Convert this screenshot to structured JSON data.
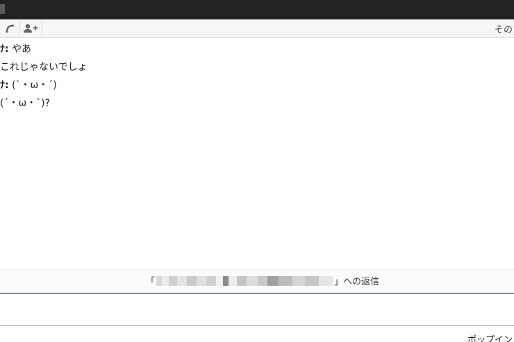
{
  "toolbar": {
    "call_icon": "phone-handset-icon",
    "add_person_icon": "add-person-icon",
    "more_label": "その"
  },
  "messages": [
    {
      "sender": "ﾅ:",
      "text": "やあ",
      "sender_visible": true
    },
    {
      "sender": "",
      "text": "これじゃないでしょ",
      "sender_visible": false
    },
    {
      "sender": "ﾅ:",
      "text": "(`・ω・´)",
      "sender_visible": true
    },
    {
      "sender": "",
      "text": "(´・ω・`)?",
      "sender_visible": false
    }
  ],
  "reply": {
    "open_bracket": "「",
    "close_label": "」への返信"
  },
  "input": {
    "value": "",
    "placeholder": ""
  },
  "footer": {
    "popin_label": "ポップイン"
  },
  "colors": {
    "title_bar": "#222222",
    "input_border": "#4d90fe"
  }
}
